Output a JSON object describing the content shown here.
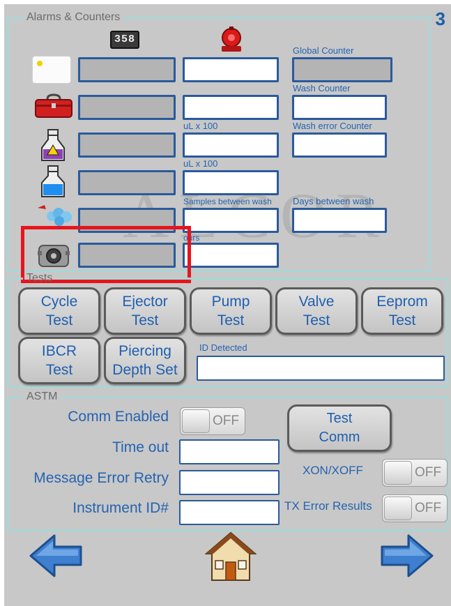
{
  "page_number": "3",
  "watermark": "ALCOR",
  "alarms": {
    "legend": "Alarms & Counters",
    "counter_icon_text": "358",
    "labels": {
      "global_counter": "Global Counter",
      "wash_counter": "Wash Counter",
      "ul_x100_a": "uL x 100",
      "wash_error_counter": "Wash error Counter",
      "ul_x100_b": "uL x 100",
      "samples_between_wash": "Samples between wash",
      "days_between_wash": "Days between wash",
      "hours": "ours"
    },
    "icons": [
      "card-icon",
      "toolbox-icon",
      "biohazard-bottle-icon",
      "blue-liquid-bottle-icon",
      "spray-cleaner-icon",
      "peristaltic-pump-icon"
    ]
  },
  "tests": {
    "legend": "Tests",
    "buttons": [
      [
        "Cycle",
        "Test"
      ],
      [
        "Ejector",
        "Test"
      ],
      [
        "Pump",
        "Test"
      ],
      [
        "Valve",
        "Test"
      ],
      [
        "Eeprom",
        "Test"
      ],
      [
        "IBCR",
        "Test"
      ],
      [
        "Piercing",
        "Depth Set"
      ]
    ],
    "id_detected_label": "ID Detected",
    "id_detected_value": ""
  },
  "astm": {
    "legend": "ASTM",
    "comm_enabled_label": "Comm Enabled",
    "comm_enabled_state": "OFF",
    "timeout_label": "Time out",
    "message_error_retry_label": "Message Error Retry",
    "instrument_id_label": "Instrument ID#",
    "test_comm": [
      "Test",
      "Comm"
    ],
    "xon_xoff_label": "XON/XOFF",
    "xon_xoff_state": "OFF",
    "tx_error_results_label": "TX Error Results",
    "tx_error_results_state": "OFF"
  },
  "nav": {
    "back_icon": "left-arrow-icon",
    "home_icon": "home-icon",
    "forward_icon": "right-arrow-icon"
  },
  "colors": {
    "label_blue": "#2563b0",
    "field_border": "#2a5a9c",
    "group_border": "#a9d6d6",
    "highlight": "#e8141c",
    "background": "#c8c8c8"
  }
}
